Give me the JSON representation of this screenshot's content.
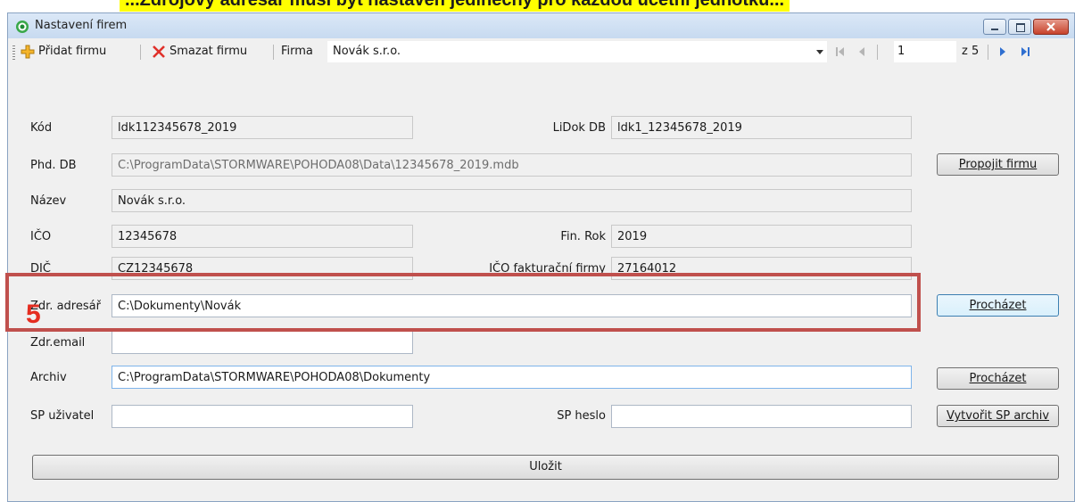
{
  "banner": {
    "text": "...Zdrojový adresář musí být nastaven jedinečný pro každou účetní jednotku..."
  },
  "window": {
    "title": "Nastavení firem"
  },
  "toolbar": {
    "add_label": "Přidat firmu",
    "delete_label": "Smazat firmu",
    "company_label": "Firma",
    "company_value": "Novák s.r.o.",
    "page_current": "1",
    "page_total": "z 5"
  },
  "form": {
    "kod_label": "Kód",
    "kod_value": "ldk112345678_2019",
    "lidok_label": "LiDok DB",
    "lidok_value": "ldk1_12345678_2019",
    "phd_label": "Phd. DB",
    "phd_value": "C:\\ProgramData\\STORMWARE\\POHODA08\\Data\\12345678_2019.mdb",
    "propojit_label": "Propojit firmu",
    "nazev_label": "Název",
    "nazev_value": "Novák s.r.o.",
    "ico_label": "IČO",
    "ico_value": "12345678",
    "finrok_label": "Fin. Rok",
    "finrok_value": "2019",
    "dic_label": "DIČ",
    "dic_value": "CZ12345678",
    "ico_fakt_label": "IČO fakturační firmy",
    "ico_fakt_value": "27164012",
    "zdr_adresar_label": "Zdr. adresář",
    "zdr_adresar_value": "C:\\Dokumenty\\Novák",
    "prochazet1_label": "Procházet",
    "zdr_email_label": "Zdr.email",
    "zdr_email_value": "",
    "archiv_label": "Archiv",
    "archiv_value": "C:\\ProgramData\\STORMWARE\\POHODA08\\Dokumenty",
    "prochazet2_label": "Procházet",
    "sp_user_label": "SP uživatel",
    "sp_user_value": "",
    "sp_heslo_label": "SP heslo",
    "sp_heslo_value": "",
    "vytvorit_label": "Vytvořit SP archiv",
    "ulozit_label": "Uložit"
  },
  "annotation": {
    "step": "5",
    "color": "#c0504d",
    "number_color": "#e52d20"
  },
  "colors": {
    "banner_bg": "#ffff00",
    "window_bg": "#f0f0f0",
    "titlebar": "#dbe8f7"
  }
}
